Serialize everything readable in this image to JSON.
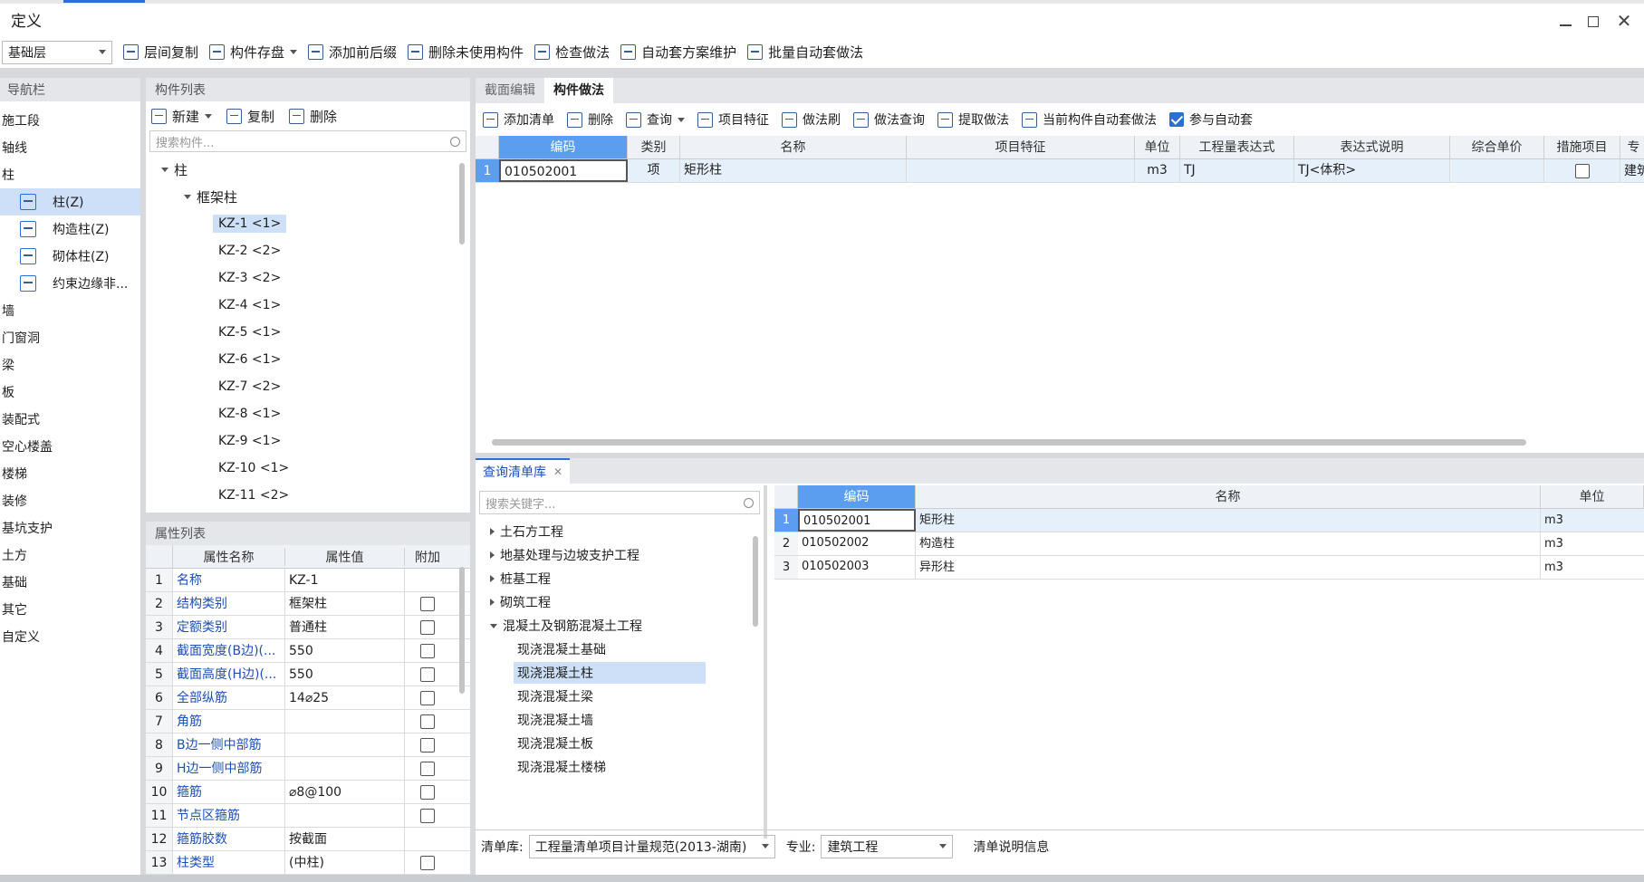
{
  "window": {
    "title": "定义"
  },
  "toolbar": {
    "floor_select": "基础层",
    "items": [
      "层间复制",
      "构件存盘",
      "添加前后缀",
      "删除未使用构件",
      "检查做法",
      "自动套方案维护",
      "批量自动套做法"
    ]
  },
  "nav": {
    "title": "导航栏",
    "items": [
      {
        "label": "施工段",
        "sub": false
      },
      {
        "label": "轴线",
        "sub": false
      },
      {
        "label": "柱",
        "sub": false
      },
      {
        "label": "柱(Z)",
        "sub": true,
        "icon": "column-icon",
        "selected": true
      },
      {
        "label": "构造柱(Z)",
        "sub": true,
        "icon": "constructional-column-icon"
      },
      {
        "label": "砌体柱(Z)",
        "sub": true,
        "icon": "masonry-column-icon"
      },
      {
        "label": "约束边缘非...",
        "sub": true,
        "icon": "edge-column-icon"
      },
      {
        "label": "墙",
        "sub": false
      },
      {
        "label": "门窗洞",
        "sub": false
      },
      {
        "label": "梁",
        "sub": false
      },
      {
        "label": "板",
        "sub": false
      },
      {
        "label": "装配式",
        "sub": false
      },
      {
        "label": "空心楼盖",
        "sub": false
      },
      {
        "label": "楼梯",
        "sub": false
      },
      {
        "label": "装修",
        "sub": false
      },
      {
        "label": "基坑支护",
        "sub": false
      },
      {
        "label": "土方",
        "sub": false
      },
      {
        "label": "基础",
        "sub": false
      },
      {
        "label": "其它",
        "sub": false
      },
      {
        "label": "自定义",
        "sub": false
      }
    ]
  },
  "component_list": {
    "title": "构件列表",
    "buttons": [
      "新建",
      "复制",
      "删除"
    ],
    "search_placeholder": "搜索构件...",
    "tree_root": "柱",
    "tree_group": "框架柱",
    "items": [
      "KZ-1 <1>",
      "KZ-2 <2>",
      "KZ-3 <2>",
      "KZ-4 <1>",
      "KZ-5 <1>",
      "KZ-6 <1>",
      "KZ-7 <2>",
      "KZ-8 <1>",
      "KZ-9 <1>",
      "KZ-10 <1>",
      "KZ-11 <2>"
    ]
  },
  "property_list": {
    "title": "属性列表",
    "headers": [
      "属性名称",
      "属性值",
      "附加"
    ],
    "rows": [
      {
        "num": "1",
        "name": "名称",
        "value": "KZ-1",
        "check": false
      },
      {
        "num": "2",
        "name": "结构类别",
        "value": "框架柱",
        "check": true
      },
      {
        "num": "3",
        "name": "定额类别",
        "value": "普通柱",
        "check": true
      },
      {
        "num": "4",
        "name": "截面宽度(B边)(...",
        "value": "550",
        "check": true
      },
      {
        "num": "5",
        "name": "截面高度(H边)(...",
        "value": "550",
        "check": true
      },
      {
        "num": "6",
        "name": "全部纵筋",
        "value": "14⌀25",
        "check": true
      },
      {
        "num": "7",
        "name": "角筋",
        "value": "",
        "check": true
      },
      {
        "num": "8",
        "name": "B边一侧中部筋",
        "value": "",
        "check": true
      },
      {
        "num": "9",
        "name": "H边一侧中部筋",
        "value": "",
        "check": true
      },
      {
        "num": "10",
        "name": "箍筋",
        "value": "⌀8@100",
        "check": true
      },
      {
        "num": "11",
        "name": "节点区箍筋",
        "value": "",
        "check": true
      },
      {
        "num": "12",
        "name": "箍筋胶数",
        "value": "按截面",
        "check": false
      },
      {
        "num": "13",
        "name": "柱类型",
        "value": "(中柱)",
        "check": true
      }
    ]
  },
  "tabs": {
    "section_edit": "截面编辑",
    "component_method": "构件做法"
  },
  "method_toolbar": {
    "items": [
      "添加清单",
      "删除",
      "查询",
      "项目特征",
      "做法刷",
      "做法查询",
      "提取做法",
      "当前构件自动套做法"
    ],
    "auto_label": "参与自动套"
  },
  "method_table": {
    "headers": [
      "编码",
      "类别",
      "名称",
      "项目特征",
      "单位",
      "工程量表达式",
      "表达式说明",
      "综合单价",
      "措施项目",
      "专"
    ],
    "rows": [
      {
        "num": "1",
        "code": "010502001",
        "type": "项",
        "name": "矩形柱",
        "feature": "",
        "unit": "m3",
        "expr": "TJ",
        "desc": "TJ<体积>",
        "price": "",
        "measure": false,
        "spec": "建筑"
      }
    ]
  },
  "query": {
    "tab_label": "查询清单库",
    "search_placeholder": "搜索关键字...",
    "tree": [
      {
        "label": "土石方工程",
        "level": 0,
        "expanded": false
      },
      {
        "label": "地基处理与边坡支护工程",
        "level": 0,
        "expanded": false
      },
      {
        "label": "桩基工程",
        "level": 0,
        "expanded": false
      },
      {
        "label": "砌筑工程",
        "level": 0,
        "expanded": false
      },
      {
        "label": "混凝土及钢筋混凝土工程",
        "level": 0,
        "expanded": true
      },
      {
        "label": "现浇混凝土基础",
        "level": 1
      },
      {
        "label": "现浇混凝土柱",
        "level": 1,
        "selected": true
      },
      {
        "label": "现浇混凝土梁",
        "level": 1
      },
      {
        "label": "现浇混凝土墙",
        "level": 1
      },
      {
        "label": "现浇混凝土板",
        "level": 1
      },
      {
        "label": "现浇混凝土楼梯",
        "level": 1
      }
    ],
    "table_headers": [
      "编码",
      "名称",
      "单位"
    ],
    "table_rows": [
      {
        "num": "1",
        "code": "010502001",
        "name": "矩形柱",
        "unit": "m3"
      },
      {
        "num": "2",
        "code": "010502002",
        "name": "构造柱",
        "unit": "m3"
      },
      {
        "num": "3",
        "code": "010502003",
        "name": "异形柱",
        "unit": "m3"
      }
    ]
  },
  "footer": {
    "lib_label": "清单库:",
    "lib_value": "工程量清单项目计量规范(2013-湖南)",
    "spec_label": "专业:",
    "spec_value": "建筑工程",
    "info_label": "清单说明信息"
  },
  "colors": {
    "accent": "#2a6fd1",
    "selected": "#cde0f7",
    "header_blue": "#5b9ef0",
    "link": "#1f4fb3"
  }
}
